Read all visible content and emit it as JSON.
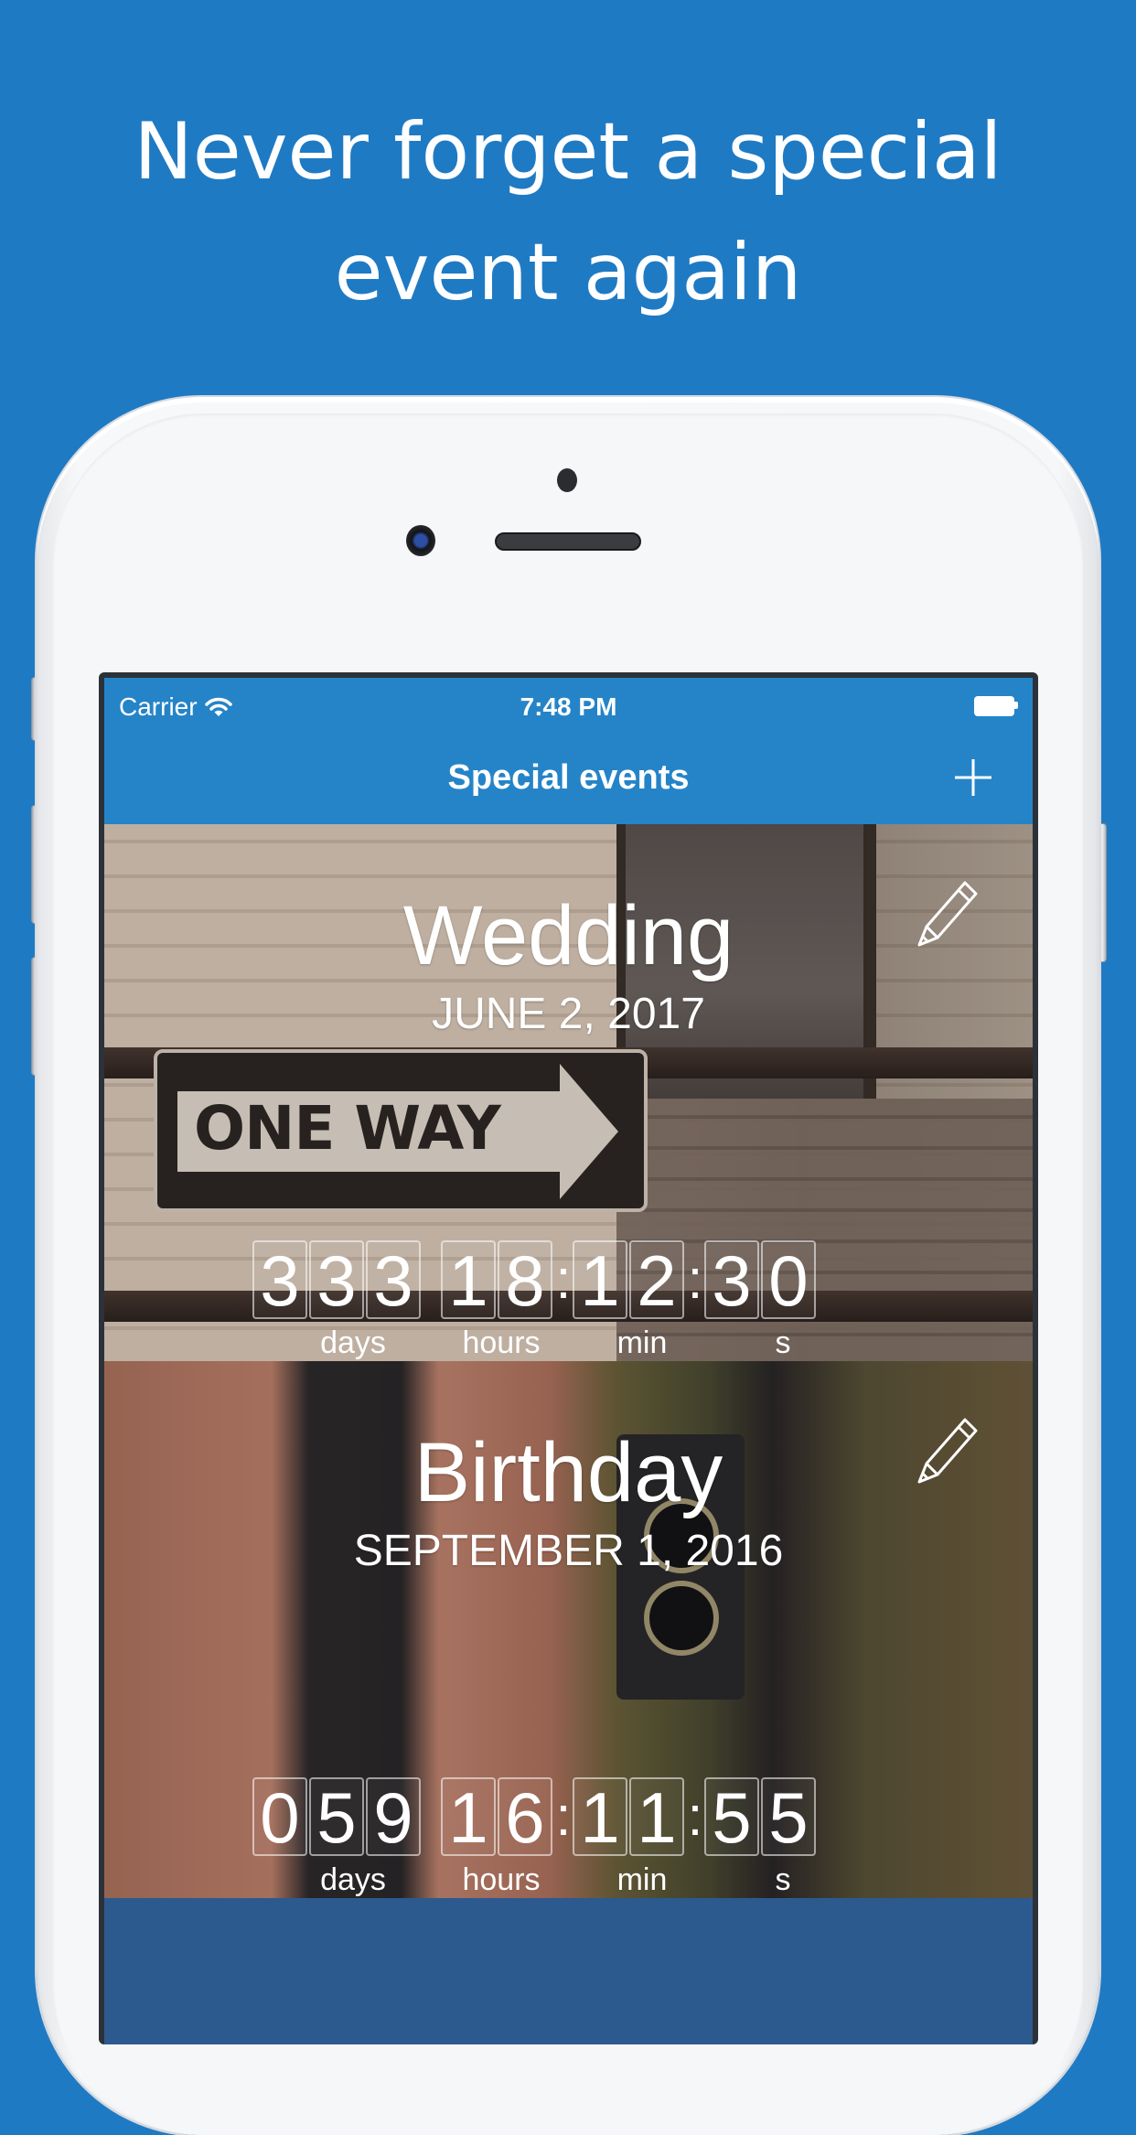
{
  "headline": {
    "line1": "Never forget a special",
    "line2": "event again"
  },
  "colors": {
    "background": "#1f7ac4",
    "navbar": "#2584c8",
    "screen_bottom": "#2c5a8e",
    "text": "#ffffff"
  },
  "statusbar": {
    "carrier": "Carrier",
    "time": "7:48 PM",
    "wifi_icon": "wifi-icon",
    "battery_icon": "battery-icon"
  },
  "navbar": {
    "title": "Special events",
    "add_icon": "plus-icon"
  },
  "events": [
    {
      "title": "Wedding",
      "date": "JUNE 2, 2017",
      "edit_icon": "pencil-icon",
      "background_image": "one-way-sign-photo",
      "sign_text": "ONE WAY",
      "countdown": {
        "days": [
          "3",
          "3",
          "3"
        ],
        "hours": [
          "1",
          "8"
        ],
        "min": [
          "1",
          "2"
        ],
        "s": [
          "3",
          "0"
        ],
        "separator": ":"
      },
      "units": {
        "days": "days",
        "hours": "hours",
        "min": "min",
        "s": "s"
      }
    },
    {
      "title": "Birthday",
      "date": "SEPTEMBER 1, 2016",
      "edit_icon": "pencil-icon",
      "background_image": "camera-photo",
      "countdown": {
        "days": [
          "0",
          "5",
          "9"
        ],
        "hours": [
          "1",
          "6"
        ],
        "min": [
          "1",
          "1"
        ],
        "s": [
          "5",
          "5"
        ],
        "separator": ":"
      },
      "units": {
        "days": "days",
        "hours": "hours",
        "min": "min",
        "s": "s"
      }
    }
  ]
}
